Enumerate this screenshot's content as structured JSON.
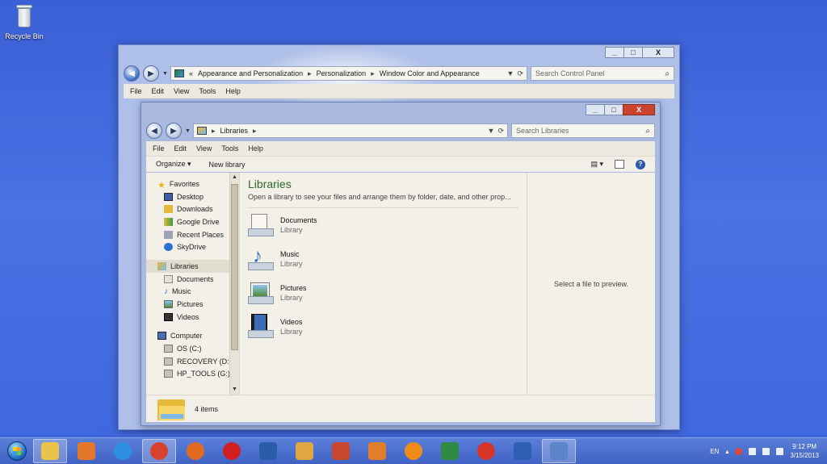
{
  "desktop": {
    "recycle_bin_label": "Recycle Bin"
  },
  "outer_window": {
    "caption": {
      "minimize": "_",
      "maximize": "□",
      "close": "X"
    },
    "address": {
      "prefix": "«",
      "crumbs": [
        "Appearance and Personalization",
        "Personalization",
        "Window Color and Appearance"
      ]
    },
    "search_placeholder": "Search Control Panel",
    "menu": [
      "File",
      "Edit",
      "View",
      "Tools",
      "Help"
    ]
  },
  "inner_window": {
    "caption": {
      "minimize": "_",
      "maximize": "□",
      "close": "X"
    },
    "address": {
      "crumbs": [
        "Libraries"
      ]
    },
    "search_placeholder": "Search Libraries",
    "menu": [
      "File",
      "Edit",
      "View",
      "Tools",
      "Help"
    ],
    "toolbar": {
      "organize": "Organize ▾",
      "new_library": "New library"
    },
    "sidebar": {
      "favorites_label": "Favorites",
      "favorites": [
        "Desktop",
        "Downloads",
        "Google Drive",
        "Recent Places",
        "SkyDrive"
      ],
      "libraries_label": "Libraries",
      "libraries": [
        "Documents",
        "Music",
        "Pictures",
        "Videos"
      ],
      "computer_label": "Computer",
      "drives": [
        "OS (C:)",
        "RECOVERY (D:)",
        "HP_TOOLS (G:)"
      ]
    },
    "main": {
      "title": "Libraries",
      "subtitle": "Open a library to see your files and arrange them by folder, date, and other prop...",
      "items": [
        {
          "name": "Documents",
          "type": "Library"
        },
        {
          "name": "Music",
          "type": "Library"
        },
        {
          "name": "Pictures",
          "type": "Library"
        },
        {
          "name": "Videos",
          "type": "Library"
        }
      ]
    },
    "preview_text": "Select a file to preview.",
    "status": {
      "count": "4 items"
    }
  },
  "taskbar": {
    "language": "EN",
    "time": "9:12 PM",
    "date": "3/15/2013",
    "apps": [
      {
        "name": "file-explorer",
        "color": "#e9c34a"
      },
      {
        "name": "media-player",
        "color": "#e3772b"
      },
      {
        "name": "internet-explorer",
        "color": "#2d8fe0"
      },
      {
        "name": "chrome",
        "color": "#d9412f"
      },
      {
        "name": "firefox",
        "color": "#e26a1e"
      },
      {
        "name": "opera",
        "color": "#d21f1f"
      },
      {
        "name": "app-blue",
        "color": "#2a5ca8"
      },
      {
        "name": "app-folder",
        "color": "#e0a640"
      },
      {
        "name": "app-red",
        "color": "#c9472f"
      },
      {
        "name": "app-orange",
        "color": "#e07e2b"
      },
      {
        "name": "avast",
        "color": "#f08a1b"
      },
      {
        "name": "app-green",
        "color": "#2f8a44"
      },
      {
        "name": "ccleaner",
        "color": "#d7352a"
      },
      {
        "name": "malwarebytes",
        "color": "#2c5fb4"
      },
      {
        "name": "control-panel",
        "color": "#5b86c9"
      }
    ]
  }
}
